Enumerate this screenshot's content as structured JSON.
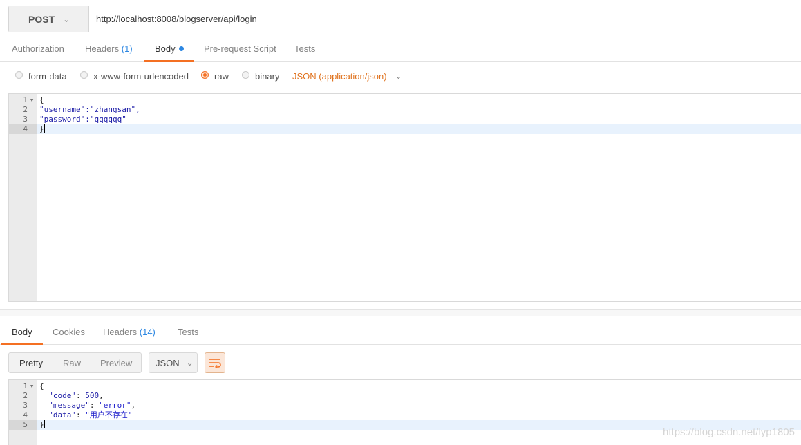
{
  "request": {
    "method": "POST",
    "url": "http://localhost:8008/blogserver/api/login",
    "tabs": [
      {
        "label": "Authorization",
        "count": ""
      },
      {
        "label": "Headers",
        "count": "(1)"
      },
      {
        "label": "Body",
        "count": ""
      },
      {
        "label": "Pre-request Script",
        "count": ""
      },
      {
        "label": "Tests",
        "count": ""
      }
    ],
    "body_types": [
      "form-data",
      "x-www-form-urlencoded",
      "raw",
      "binary"
    ],
    "selected_body_type": "raw",
    "content_type": "JSON (application/json)",
    "line_numbers": [
      "1",
      "2",
      "3",
      "4"
    ],
    "body_lines": [
      "{",
      "\"username\":\"zhangsan\",",
      "\"password\":\"qqqqqq\"",
      "}"
    ]
  },
  "response": {
    "tabs": [
      {
        "label": "Body",
        "count": ""
      },
      {
        "label": "Cookies",
        "count": ""
      },
      {
        "label": "Headers",
        "count": "(14)"
      },
      {
        "label": "Tests",
        "count": ""
      }
    ],
    "view_modes": [
      "Pretty",
      "Raw",
      "Preview"
    ],
    "format": "JSON",
    "line_numbers": [
      "1",
      "2",
      "3",
      "4",
      "5"
    ],
    "code": "500",
    "message": "error",
    "data_text": "用户不存在"
  },
  "watermark": "https://blog.csdn.net/lyp1805"
}
